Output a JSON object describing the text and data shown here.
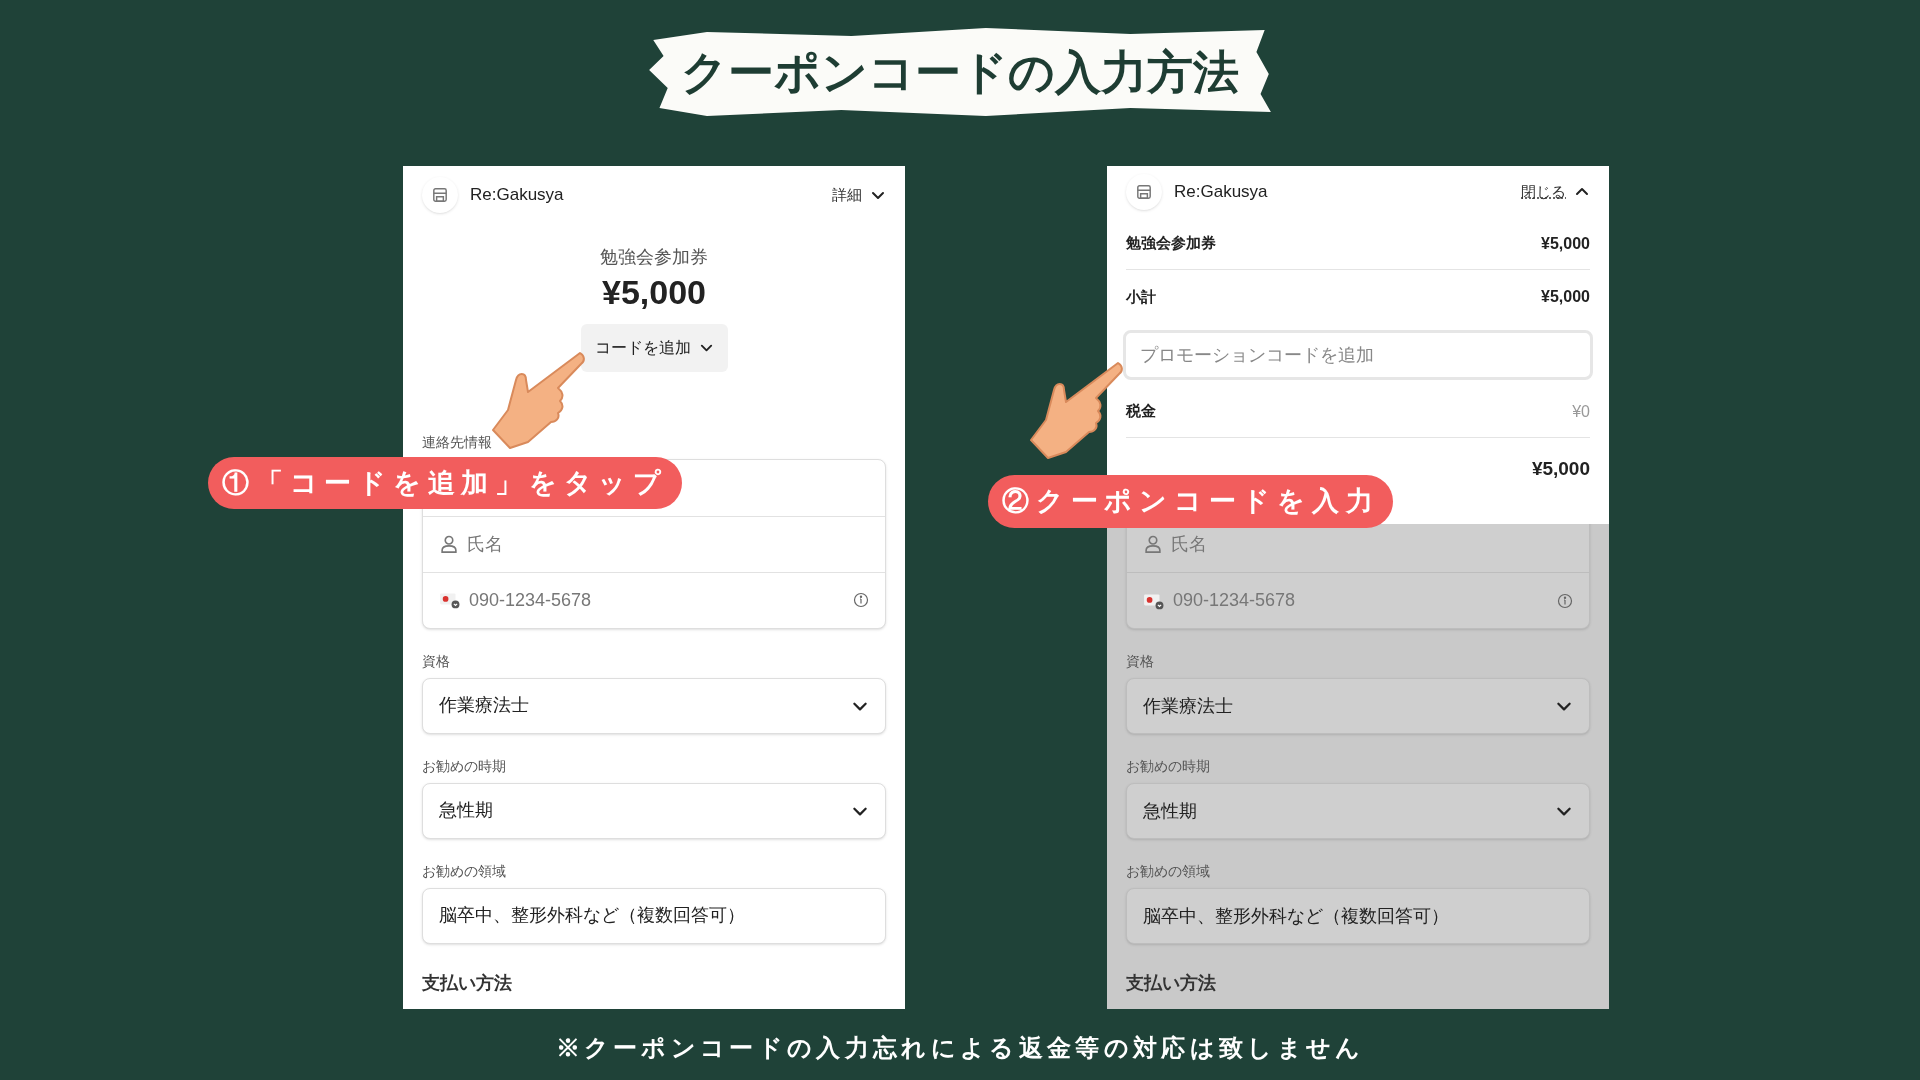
{
  "title": "クーポンコードの入力方法",
  "screens": [
    {
      "kind": "collapsed",
      "dimmed": false,
      "store_name": "Re:Gakusya",
      "toggle_link": "詳細",
      "product": "勉強会参加券",
      "price": "¥5,000",
      "add_code_button": "コードを追加",
      "contact_label": "連絡先情報",
      "contact_fields": [
        {
          "kind": "blank"
        },
        {
          "kind": "name",
          "placeholder": "氏名"
        },
        {
          "kind": "phone",
          "placeholder": "090-1234-5678"
        }
      ],
      "fields": [
        {
          "label": "資格",
          "kind": "select",
          "value": "作業療法士"
        },
        {
          "label": "お勧めの時期",
          "kind": "select",
          "value": "急性期"
        },
        {
          "label": "お勧めの領域",
          "kind": "text",
          "value": "脳卒中、整形外科など（複数回答可）"
        }
      ],
      "payment_heading": "支払い方法"
    },
    {
      "kind": "expanded",
      "dimmed": true,
      "store_name": "Re:Gakusya",
      "toggle_link": "閉じる",
      "summary": [
        {
          "kind": "item",
          "label": "勉強会参加券",
          "amount": "¥5,000"
        },
        {
          "kind": "subtotal",
          "label": "小計",
          "amount": "¥5,000"
        },
        {
          "kind": "promo",
          "placeholder": "プロモーションコードを追加"
        },
        {
          "kind": "tax",
          "label": "税金",
          "amount": "¥0"
        },
        {
          "kind": "total",
          "amount": "¥5,000"
        }
      ],
      "contact_fields": [
        {
          "kind": "name",
          "placeholder": "氏名"
        },
        {
          "kind": "phone",
          "placeholder": "090-1234-5678"
        }
      ],
      "fields": [
        {
          "label": "資格",
          "kind": "select",
          "value": "作業療法士"
        },
        {
          "label": "お勧めの時期",
          "kind": "select",
          "value": "急性期"
        },
        {
          "label": "お勧めの領域",
          "kind": "text",
          "value": "脳卒中、整形外科など（複数回答可）"
        }
      ],
      "payment_heading": "支払い方法"
    }
  ],
  "callouts": [
    "①「コードを追加」をタップ",
    "②クーポンコードを入力"
  ],
  "footnote": "※クーポンコードの入力忘れによる返金等の対応は致しません"
}
